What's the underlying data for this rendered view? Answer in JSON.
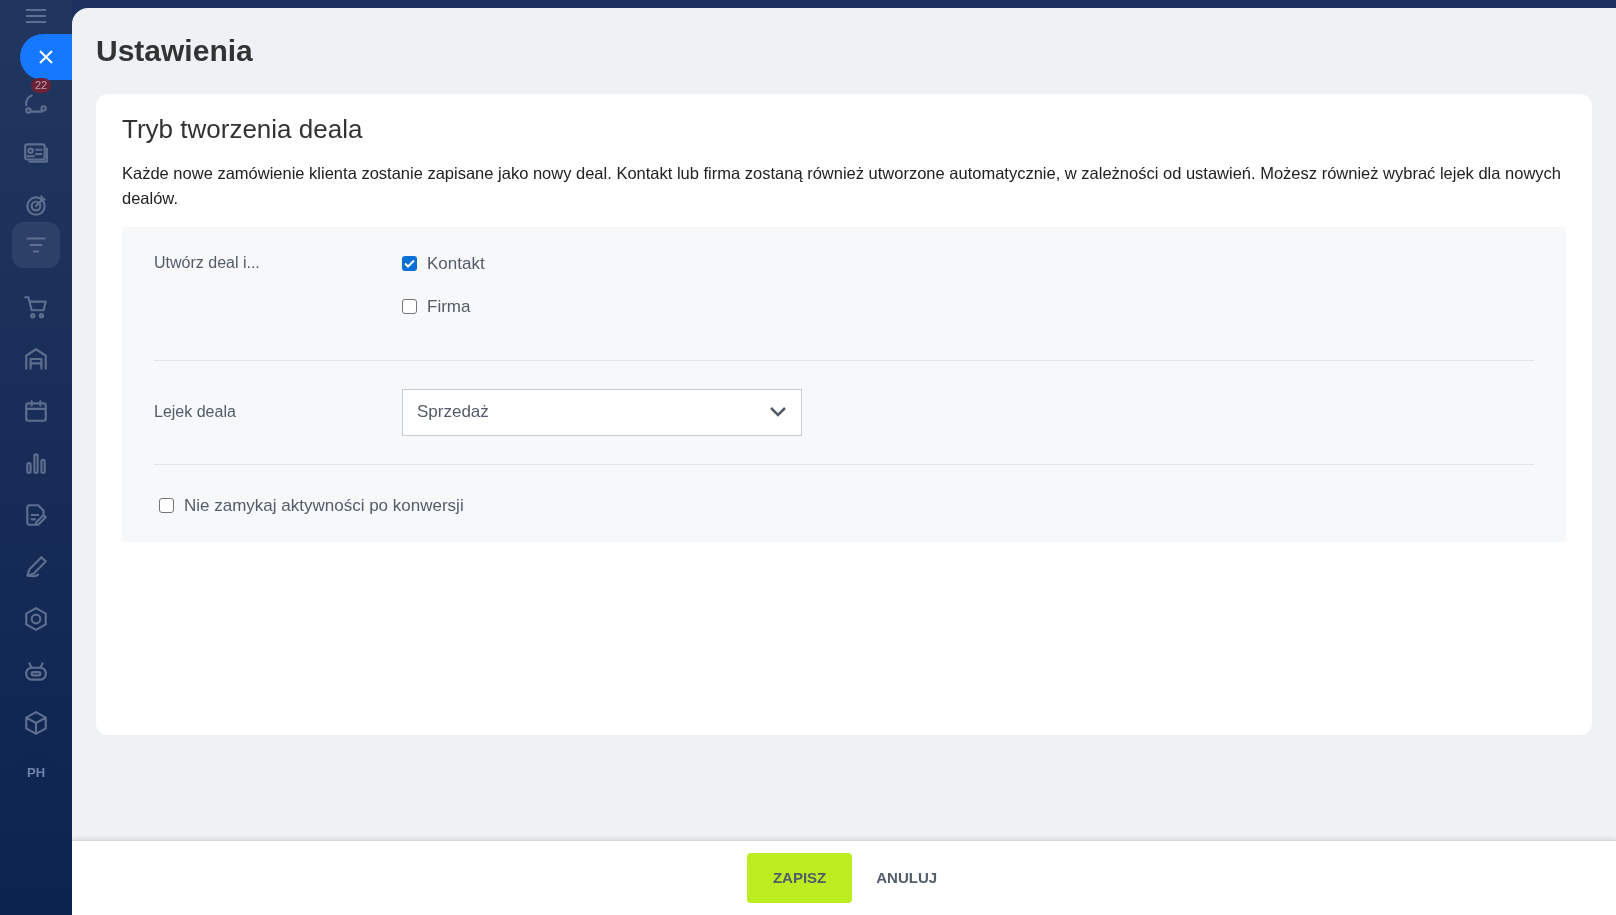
{
  "sidebar": {
    "badge": "22",
    "avatar_initials": "PH"
  },
  "title": "Ustawienia",
  "section": {
    "heading": "Tryb tworzenia deala",
    "description": "Każde nowe zamówienie klienta zostanie zapisane jako nowy deal. Kontakt lub firma zostaną również utworzone automatycznie, w zależności od ustawień. Możesz również wybrać lejek dla nowych dealów."
  },
  "create_with": {
    "label": "Utwórz deal i...",
    "options": [
      {
        "label": "Kontakt",
        "checked": true
      },
      {
        "label": "Firma",
        "checked": false
      }
    ]
  },
  "pipeline": {
    "label": "Lejek deala",
    "value": "Sprzedaż"
  },
  "keep_activities": {
    "label": "Nie zamykaj aktywności po konwersji",
    "checked": false
  },
  "buttons": [
    {
      "label": "ZAPISZ",
      "kind": "primary"
    },
    {
      "label": "ANULUJ",
      "kind": "link"
    }
  ]
}
